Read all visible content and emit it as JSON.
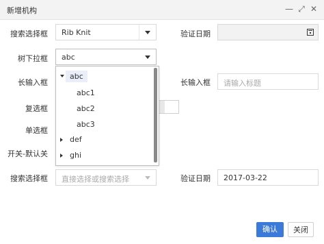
{
  "window": {
    "title": "新增机构",
    "controls": {
      "minimize": "—",
      "maximize": "⤢",
      "close": "✕"
    }
  },
  "form": {
    "row1": {
      "left_label": "搜索选择框",
      "left_value": "Rib Knit",
      "right_label": "验证日期",
      "right_value": ""
    },
    "row2": {
      "left_label": "树下拉框",
      "left_value": "abc"
    },
    "row3": {
      "left_label": "长输入框",
      "right_label": "长输入框",
      "right_placeholder": "请输入标题"
    },
    "row4": {
      "left_label": "复选框"
    },
    "row5": {
      "left_label": "单选框"
    },
    "row6": {
      "left_label": "开关-默认关"
    },
    "row7": {
      "left_label": "搜索选择框",
      "left_placeholder": "直接选择或搜索选择",
      "right_label": "验证日期",
      "right_value": "2017-03-22"
    }
  },
  "tree_dropdown": {
    "nodes": [
      {
        "label": "abc",
        "level": 0,
        "expanded": true,
        "selected": true
      },
      {
        "label": "abc1",
        "level": 1
      },
      {
        "label": "abc2",
        "level": 1
      },
      {
        "label": "abc3",
        "level": 1
      },
      {
        "label": "def",
        "level": 0,
        "expanded": false
      },
      {
        "label": "ghi",
        "level": 0,
        "expanded": false
      }
    ]
  },
  "buttons": {
    "confirm": "确认",
    "close": "关闭"
  },
  "colors": {
    "primary": "#3b7ad9",
    "border": "#d9d9d9",
    "titlebar": "#f3f3f3",
    "selected_bg": "#e9eef9"
  },
  "icons": [
    "minimize-icon",
    "maximize-icon",
    "close-icon",
    "dropdown-caret-icon",
    "calendar-icon",
    "tree-expand-icon",
    "tree-collapse-icon"
  ]
}
